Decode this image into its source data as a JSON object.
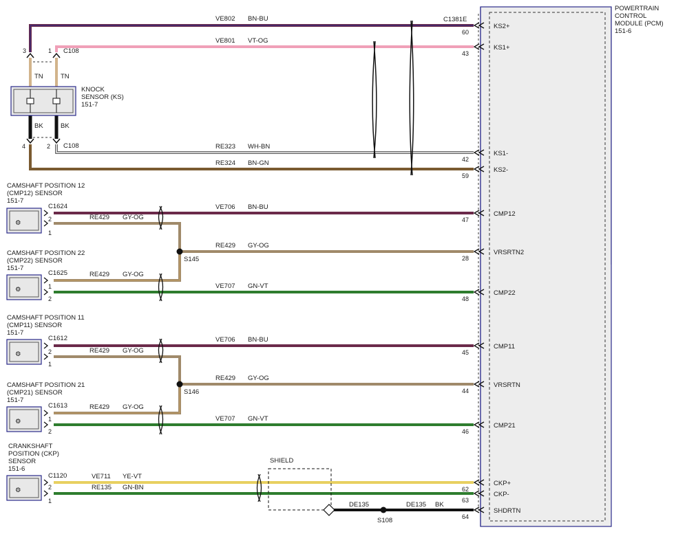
{
  "pcm": {
    "title_lines": [
      "POWERTRAIN",
      "CONTROL",
      "MODULE (PCM)",
      "151-6"
    ],
    "connector": "C1381E"
  },
  "colors": {
    "BN-BU": "#6b2a4a",
    "VT-OG": "#f0a0b8",
    "WH-BN": "#ffffff",
    "BN-GN": "#7a5a30",
    "GY-OG": "#a08a6a",
    "GN-VT": "#2e7d2e",
    "YE-VT": "#e8d060",
    "GN-BN": "#2e7d2e",
    "BK": "#111111",
    "TN": "#d2b48c"
  },
  "knock_sensor": {
    "title_lines": [
      "KNOCK",
      "SENSOR (KS)",
      "151-7"
    ],
    "connector_top": "C108",
    "connector_bottom": "C108",
    "pins": [
      "3",
      "1",
      "4",
      "2"
    ],
    "wire_labels": [
      "TN",
      "TN",
      "BK",
      "BK"
    ]
  },
  "sensors": [
    {
      "title_lines": [
        "CAMSHAFT POSITION 12",
        "(CMP12) SENSOR",
        "151-7"
      ],
      "connector": "C1624",
      "pins": [
        "2",
        "1"
      ]
    },
    {
      "title_lines": [
        "CAMSHAFT POSITION 22",
        "(CMP22) SENSOR",
        "151-7"
      ],
      "connector": "C1625",
      "pins": [
        "1",
        "2"
      ]
    },
    {
      "title_lines": [
        "CAMSHAFT POSITION 11",
        "(CMP11) SENSOR",
        "151-7"
      ],
      "connector": "C1612",
      "pins": [
        "2",
        "1"
      ]
    },
    {
      "title_lines": [
        "CAMSHAFT POSITION 21",
        "(CMP21) SENSOR",
        "151-7"
      ],
      "connector": "C1613",
      "pins": [
        "1",
        "2"
      ]
    },
    {
      "title_lines": [
        "CRANKSHAFT",
        "POSITION (CKP)",
        "SENSOR",
        "151-6"
      ],
      "connector": "C1120",
      "pins": [
        "1",
        "2",
        "1"
      ]
    }
  ],
  "circuits": [
    {
      "circuit": "VE802",
      "color": "BN-BU",
      "pin": "60",
      "signal": "KS2+"
    },
    {
      "circuit": "VE801",
      "color": "VT-OG",
      "pin": "43",
      "signal": "KS1+"
    },
    {
      "circuit": "RE323",
      "color": "WH-BN",
      "pin": "42",
      "signal": "KS1-"
    },
    {
      "circuit": "RE324",
      "color": "BN-GN",
      "pin": "59",
      "signal": "KS2-"
    },
    {
      "circuit": "VE706",
      "color": "BN-BU",
      "pin": "47",
      "signal": "CMP12"
    },
    {
      "circuit": "RE429",
      "color": "GY-OG",
      "pin": "28",
      "signal": "VRSRTN2"
    },
    {
      "circuit": "VE707",
      "color": "GN-VT",
      "pin": "48",
      "signal": "CMP22"
    },
    {
      "circuit": "VE706",
      "color": "BN-BU",
      "pin": "45",
      "signal": "CMP11"
    },
    {
      "circuit": "RE429",
      "color": "GY-OG",
      "pin": "44",
      "signal": "VRSRTN"
    },
    {
      "circuit": "VE707",
      "color": "GN-VT",
      "pin": "46",
      "signal": "CMP21"
    },
    {
      "circuit": "VE711",
      "color": "YE-VT",
      "pin": "62",
      "signal": "CKP+"
    },
    {
      "circuit": "RE135",
      "color": "GN-BN",
      "pin": "63",
      "signal": "CKP-"
    },
    {
      "circuit": "",
      "color": "",
      "pin": "64",
      "signal": "SHDRTN"
    }
  ],
  "branch_labels": [
    {
      "circuit": "RE429",
      "color": "GY-OG"
    },
    {
      "circuit": "RE429",
      "color": "GY-OG"
    },
    {
      "circuit": "RE429",
      "color": "GY-OG"
    },
    {
      "circuit": "RE429",
      "color": "GY-OG"
    }
  ],
  "splices": [
    "S145",
    "S146",
    "S108"
  ],
  "shield_label": "SHIELD",
  "shield_wire": {
    "circuit_a": "DE135",
    "circuit_b": "DE135",
    "color": "BK"
  }
}
